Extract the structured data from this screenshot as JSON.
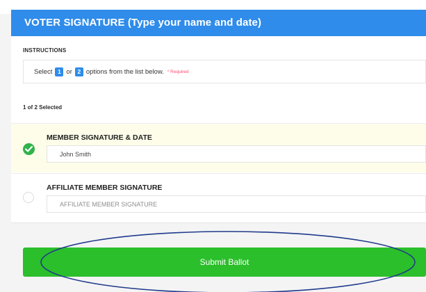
{
  "form": {
    "header_title": "VOTER SIGNATURE (Type your name and date)",
    "instructions_label": "INSTRUCTIONS",
    "instructions": {
      "select": "Select",
      "min": "1",
      "or": "or",
      "max": "2",
      "rest": "options from the list below.",
      "required": "* Required"
    },
    "selected_count": "1 of 2 Selected",
    "options": [
      {
        "title": "MEMBER SIGNATURE & DATE",
        "value": "John Smith",
        "placeholder": "",
        "selected": true
      },
      {
        "title": "AFFILIATE MEMBER SIGNATURE",
        "value": "",
        "placeholder": "AFFILIATE MEMBER SIGNATURE",
        "selected": false
      }
    ],
    "submit_label": "Submit Ballot"
  },
  "colors": {
    "header": "#2f8cea",
    "selected_background": "#fdfde9",
    "check": "#2fb34a",
    "submit": "#2bbf2b",
    "required": "#ff4a6e",
    "annotation": "#1f3a8a"
  },
  "icons": [
    "check-circle-icon",
    "radio-empty-icon"
  ]
}
